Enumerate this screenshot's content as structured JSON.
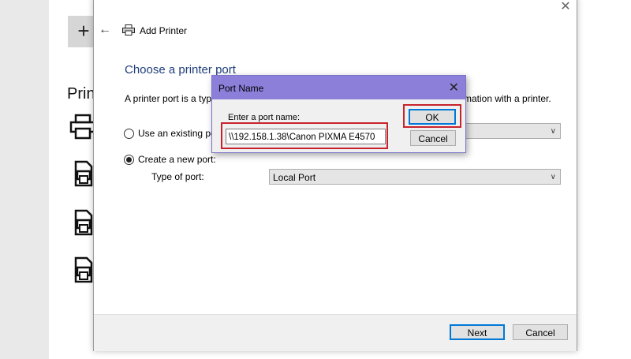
{
  "background": {
    "printers_label": "Prin",
    "add_tile_icon": "plus-icon"
  },
  "wizard": {
    "title": "Add Printer",
    "heading": "Choose a printer port",
    "description_left": "A printer port is a typ",
    "description_right": "mation with a printer.",
    "option_existing": "Use an existing po",
    "option_new": "Create a new port:",
    "type_of_port_label": "Type of port:",
    "type_of_port_value": "Local Port",
    "next_label": "Next",
    "cancel_label": "Cancel"
  },
  "dialog": {
    "title": "Port Name",
    "field_label": "Enter a port name:",
    "port_value": "\\\\192.158.1.38\\Canon PIXMA E4570",
    "ok_label": "OK",
    "cancel_label": "Cancel"
  },
  "colors": {
    "dialog_titlebar": "#8b7fd9",
    "highlight": "#c8232b",
    "heading": "#1e3d7a"
  }
}
